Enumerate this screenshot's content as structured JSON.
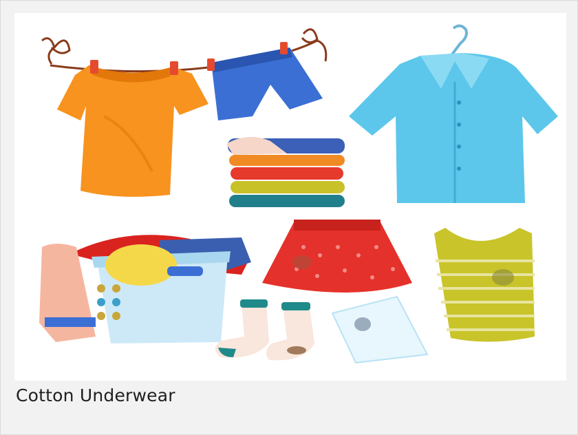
{
  "card": {
    "caption": "Cotton Underwear"
  },
  "illustration": {
    "items": [
      "orange-tshirt-on-line",
      "blue-shorts-on-line",
      "folded-clothes-stack",
      "light-blue-shirt-on-hanger",
      "laundry-basket",
      "red-polka-dot-skirt",
      "yellow-striped-tank-top",
      "dirty-socks",
      "stained-handkerchief"
    ],
    "colors": {
      "orange": "#f7931e",
      "blue_shorts": "#3b6fd4",
      "shirt_blue": "#5cc7ea",
      "skirt_red": "#e5312b",
      "tank_yellow": "#c9c42a",
      "basket_blue": "#cde9f7",
      "line_brown": "#8a3b1c"
    }
  }
}
